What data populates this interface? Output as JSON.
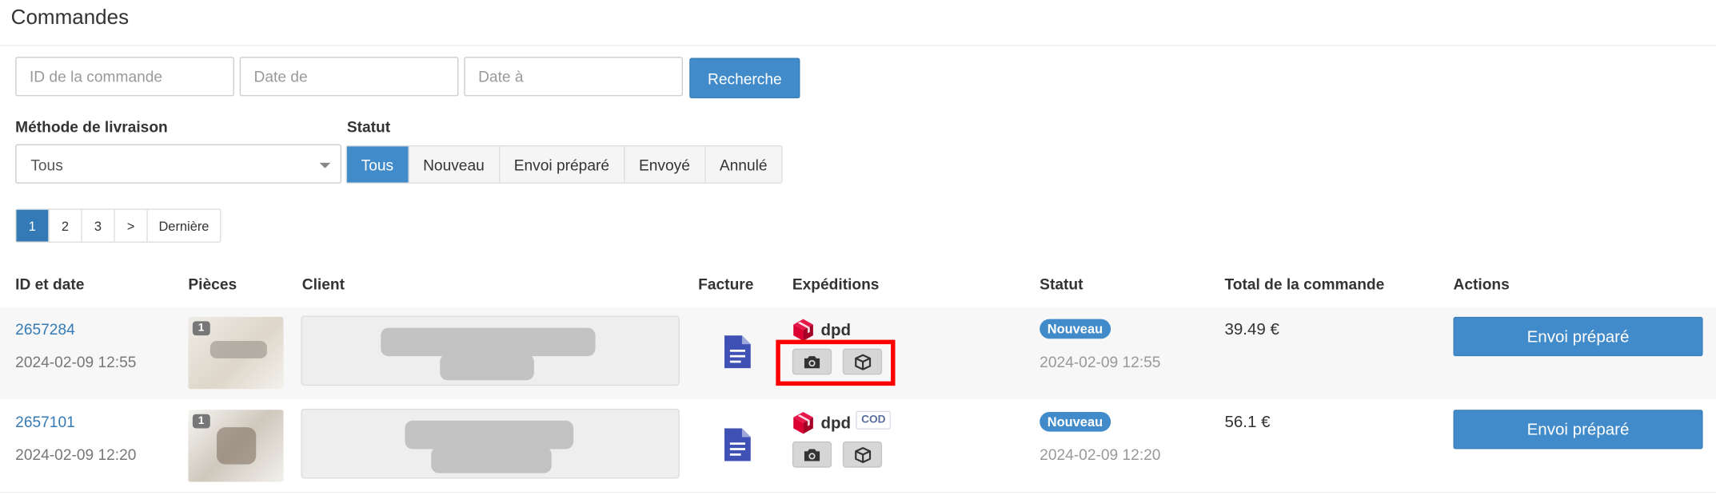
{
  "header": {
    "title": "Commandes"
  },
  "filters": {
    "order_id_placeholder": "ID de la commande",
    "date_from_placeholder": "Date de",
    "date_to_placeholder": "Date à",
    "search_label": "Recherche",
    "delivery_label": "Méthode de livraison",
    "delivery_value": "Tous",
    "status_label": "Statut",
    "status_options": [
      "Tous",
      "Nouveau",
      "Envoi préparé",
      "Envoyé",
      "Annulé"
    ],
    "status_selected": "Tous"
  },
  "pagination": {
    "pages": [
      "1",
      "2",
      "3",
      ">",
      "Dernière"
    ],
    "current": "1"
  },
  "table": {
    "headers": [
      "ID et date",
      "Pièces",
      "Client",
      "Facture",
      "Expéditions",
      "Statut",
      "Total de la commande",
      "Actions"
    ],
    "rows": [
      {
        "id": "2657284",
        "date": "2024-02-09 12:55",
        "pieces_count": "1",
        "carrier": "dpd",
        "cod": "",
        "status": "Nouveau",
        "status_date": "2024-02-09 12:55",
        "total": "39.49 €",
        "action": "Envoi préparé"
      },
      {
        "id": "2657101",
        "date": "2024-02-09 12:20",
        "pieces_count": "1",
        "carrier": "dpd",
        "cod": "COD",
        "status": "Nouveau",
        "status_date": "2024-02-09 12:20",
        "total": "56.1 €",
        "action": "Envoi préparé"
      }
    ]
  },
  "colors": {
    "primary": "#428bca",
    "link": "#337ab7",
    "highlight": "#ff0000",
    "dpd": "#dc0032",
    "invoice": "#3f51b5"
  },
  "icons": [
    "invoice-icon",
    "dpd-logo-icon",
    "camera-icon",
    "package-icon",
    "caret-down-icon"
  ]
}
